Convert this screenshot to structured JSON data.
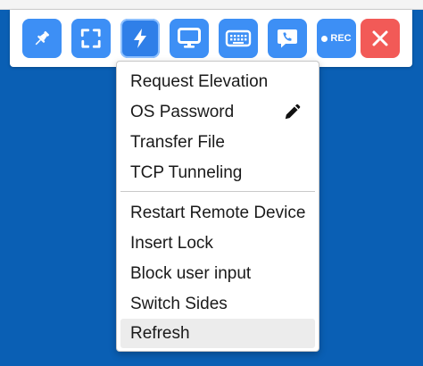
{
  "toolbar": {
    "buttons": [
      {
        "id": "pin",
        "icon": "pin-icon"
      },
      {
        "id": "fullscreen",
        "icon": "fullscreen-icon"
      },
      {
        "id": "actions",
        "icon": "lightning-icon",
        "active": true
      },
      {
        "id": "display",
        "icon": "monitor-icon"
      },
      {
        "id": "keyboard",
        "icon": "keyboard-icon"
      },
      {
        "id": "chat",
        "icon": "chat-phone-icon"
      },
      {
        "id": "record",
        "icon": "record-icon",
        "label": "REC"
      },
      {
        "id": "close",
        "icon": "close-icon"
      }
    ],
    "colors": {
      "button": "#3d8ff5",
      "close": "#f25a57"
    }
  },
  "menu": {
    "group1": [
      "Request Elevation",
      "OS Password",
      "Transfer File",
      "TCP Tunneling"
    ],
    "group2": [
      "Restart Remote Device",
      "Insert Lock",
      "Block user input",
      "Switch Sides",
      "Refresh"
    ],
    "highlighted": "Refresh",
    "edit_icon": "pencil-icon"
  },
  "colors": {
    "desktop": "#0a5fb4"
  }
}
